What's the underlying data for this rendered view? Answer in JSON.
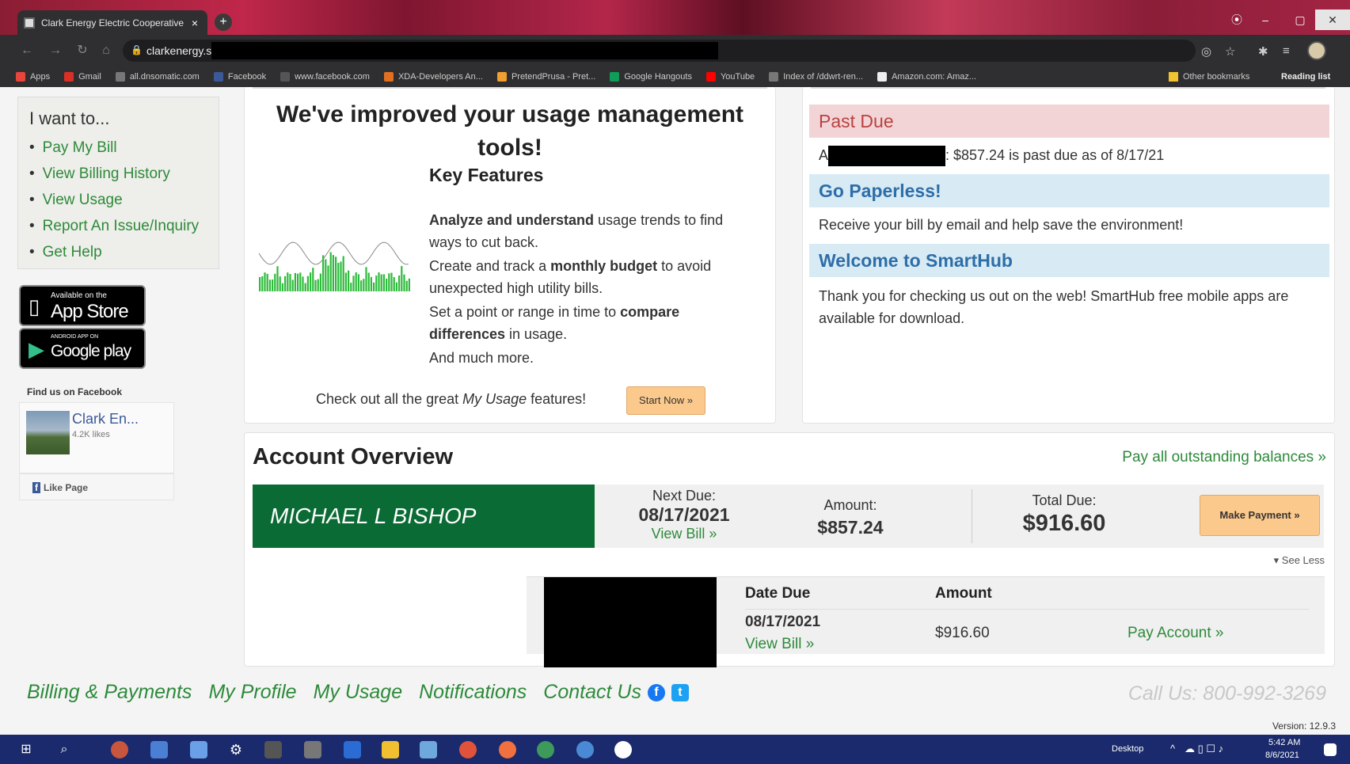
{
  "browser": {
    "tab_title": "Clark Energy Electric Cooperative",
    "tab_close": "×",
    "new_tab": "+",
    "url": "clarkenergy.s",
    "bookmarks": [
      {
        "label": "Apps",
        "color": "#e8453c"
      },
      {
        "label": "Gmail",
        "color": "#d93025"
      },
      {
        "label": "all.dnsomatic.com",
        "color": "#777777"
      },
      {
        "label": "Facebook",
        "color": "#3b5998"
      },
      {
        "label": "www.facebook.com",
        "color": "#555555"
      },
      {
        "label": "XDA-Developers An...",
        "color": "#e07020"
      },
      {
        "label": "PretendPrusa - Pret...",
        "color": "#f0a030"
      },
      {
        "label": "Google Hangouts",
        "color": "#0f9d58"
      },
      {
        "label": "YouTube",
        "color": "#ff0000"
      },
      {
        "label": "Index of /ddwrt-ren...",
        "color": "#777777"
      },
      {
        "label": "Amazon.com: Amaz...",
        "color": "#eeeeee"
      }
    ],
    "other_bookmarks": "Other bookmarks",
    "reading_list": "Reading list"
  },
  "sidebar": {
    "title": "I want to...",
    "items": [
      "Pay My Bill",
      "View Billing History",
      "View Usage",
      "Report An Issue/Inquiry",
      "Get Help"
    ],
    "appstore_small": "Available on the",
    "appstore_big": "App Store",
    "googleplay_small": "ANDROID APP ON",
    "googleplay_big": "Google play",
    "fb_title": "Find us on Facebook",
    "fb_page_name": "Clark En...",
    "fb_likes": "4.2K likes",
    "fb_like_page": "Like Page"
  },
  "usage_card": {
    "title": "We've improved your usage management tools!",
    "key_features": "Key Features",
    "f1_bold": "Analyze and understand",
    "f1_rest": " usage trends to find ways to cut back.",
    "f2_pre": "Create and track a ",
    "f2_bold": "monthly budget",
    "f2_post": " to avoid unexpected high utility bills.",
    "f3_pre": "Set a point or range in time to ",
    "f3_bold": "compare differences",
    "f3_post": " in usage.",
    "f4": "And much more.",
    "checkout_pre": "Check out all the great ",
    "checkout_em": "My Usage",
    "checkout_post": " features!",
    "start_now": "Start Now »"
  },
  "notices": {
    "past_due_title": "Past Due",
    "past_due_prefix": "A",
    "past_due_text": ": $857.24 is past due as of 8/17/21",
    "paperless_title": "Go Paperless!",
    "paperless_text": "Receive your bill by email and help save the environment!",
    "welcome_title": "Welcome to SmartHub",
    "welcome_text": "Thank you for checking us out on the web! SmartHub free mobile apps are available for download."
  },
  "overview": {
    "title": "Account Overview",
    "pay_all": "Pay all outstanding balances »",
    "account_name": "MICHAEL L BISHOP",
    "next_due_label": "Next Due:",
    "next_due_date": "08/17/2021",
    "view_bill": "View Bill »",
    "amount_label": "Amount:",
    "amount_value": "$857.24",
    "total_due_label": "Total Due:",
    "total_due_value": "$916.60",
    "make_payment": "Make Payment »",
    "see_less": "▾ See Less",
    "detail": {
      "date_due_header": "Date Due",
      "amount_header": "Amount",
      "date_due": "08/17/2021",
      "view_bill": "View Bill »",
      "amount": "$916.60",
      "pay_account": "Pay Account »"
    }
  },
  "footer": {
    "links": [
      "Billing & Payments",
      "My Profile",
      "My Usage",
      "Notifications",
      "Contact Us"
    ],
    "call_us": "Call Us: 800-992-3269",
    "version": "Version: 12.9.3"
  },
  "taskbar": {
    "desktop": "Desktop",
    "time": "5:42 AM",
    "date": "8/6/2021"
  }
}
